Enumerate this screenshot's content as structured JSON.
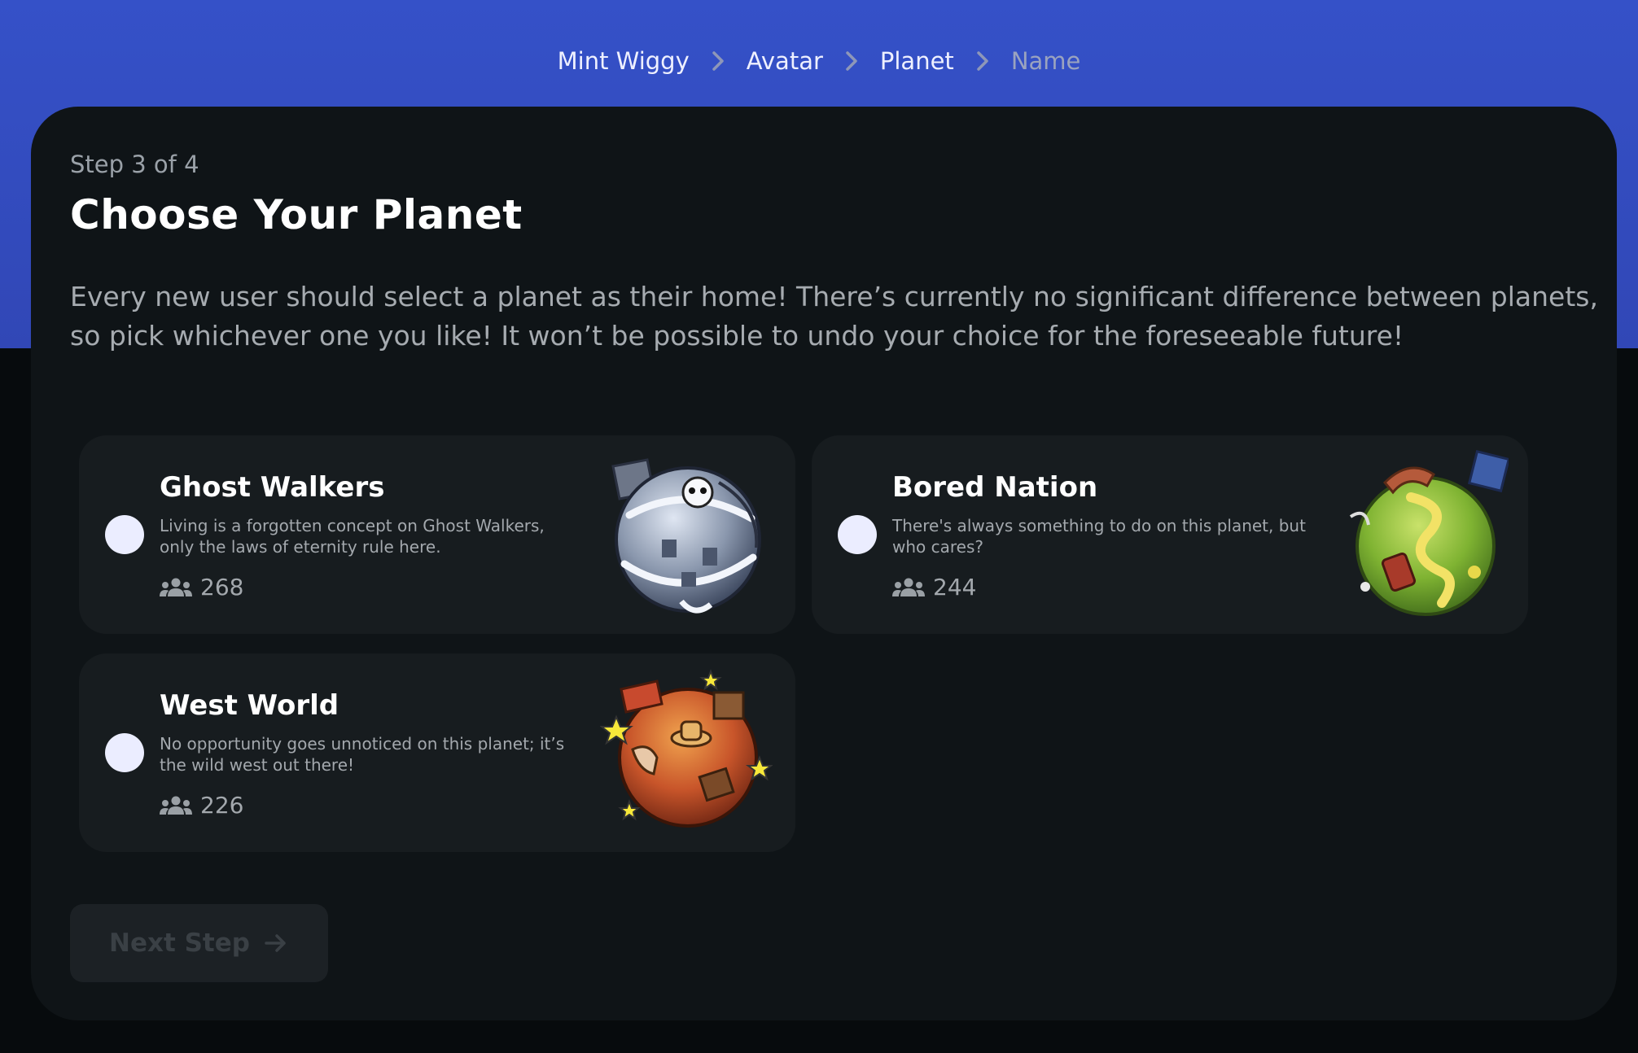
{
  "breadcrumb": {
    "items": [
      {
        "label": "Mint Wiggy",
        "active": true
      },
      {
        "label": "Avatar",
        "active": true
      },
      {
        "label": "Planet",
        "active": true
      },
      {
        "label": "Name",
        "active": false
      }
    ]
  },
  "step": {
    "label": "Step 3 of 4"
  },
  "page": {
    "title": "Choose Your Planet",
    "description": "Every new user should select a planet as their home! There’s currently no significant difference between planets, so pick whichever one you like! It won’t be possible to undo your choice for the foreseeable future!"
  },
  "planets": [
    {
      "name": "Ghost Walkers",
      "description": "Living is a forgotten concept on Ghost Walkers, only the laws of eternity rule here.",
      "members": "268",
      "icon": "ghost-planet-image"
    },
    {
      "name": "Bored Nation",
      "description": "There's always something to do on this planet, but who cares?",
      "members": "244",
      "icon": "grass-planet-image"
    },
    {
      "name": "West World",
      "description": "No opportunity goes unnoticed on this planet; it’s the wild west out there!",
      "members": "226",
      "icon": "desert-planet-image"
    }
  ],
  "next_button": {
    "label": "Next Step",
    "enabled": false
  },
  "colors": {
    "header_blue": "#3551c8",
    "card_bg": "#0f1417",
    "planet_card_bg": "#171c1f",
    "radio": "#ebedff"
  }
}
